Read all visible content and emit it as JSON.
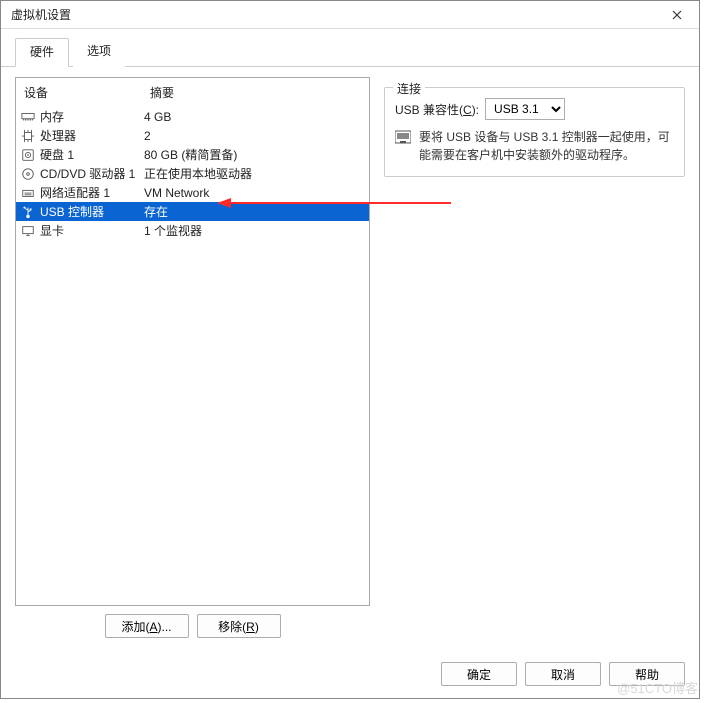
{
  "title": "虚拟机设置",
  "tabs": {
    "hardware": "硬件",
    "options": "选项"
  },
  "list_header": {
    "device": "设备",
    "summary": "摘要"
  },
  "devices": [
    {
      "icon": "memory-icon",
      "name": "内存",
      "summary": "4 GB",
      "selected": false
    },
    {
      "icon": "cpu-icon",
      "name": "处理器",
      "summary": "2",
      "selected": false
    },
    {
      "icon": "disk-icon",
      "name": "硬盘 1",
      "summary": "80 GB (精简置备)",
      "selected": false
    },
    {
      "icon": "cd-icon",
      "name": "CD/DVD 驱动器 1",
      "summary": "正在使用本地驱动器",
      "selected": false
    },
    {
      "icon": "nic-icon",
      "name": "网络适配器 1",
      "summary": "VM Network",
      "selected": false
    },
    {
      "icon": "usb-icon",
      "name": "USB 控制器",
      "summary": "存在",
      "selected": true
    },
    {
      "icon": "display-icon",
      "name": "显卡",
      "summary": "1 个监视器",
      "selected": false
    }
  ],
  "buttons": {
    "add": "添加(A)...",
    "remove": "移除(R)",
    "ok": "确定",
    "cancel": "取消",
    "help": "帮助"
  },
  "connection": {
    "group_title": "连接",
    "compat_label_prefix": "USB 兼容性(",
    "compat_label_letter": "C",
    "compat_label_suffix": "):",
    "compat_value": "USB 3.1",
    "info_text": "要将 USB 设备与 USB 3.1 控制器一起使用，可能需要在客户机中安装额外的驱动程序。"
  },
  "watermark": "@51CTO博客"
}
